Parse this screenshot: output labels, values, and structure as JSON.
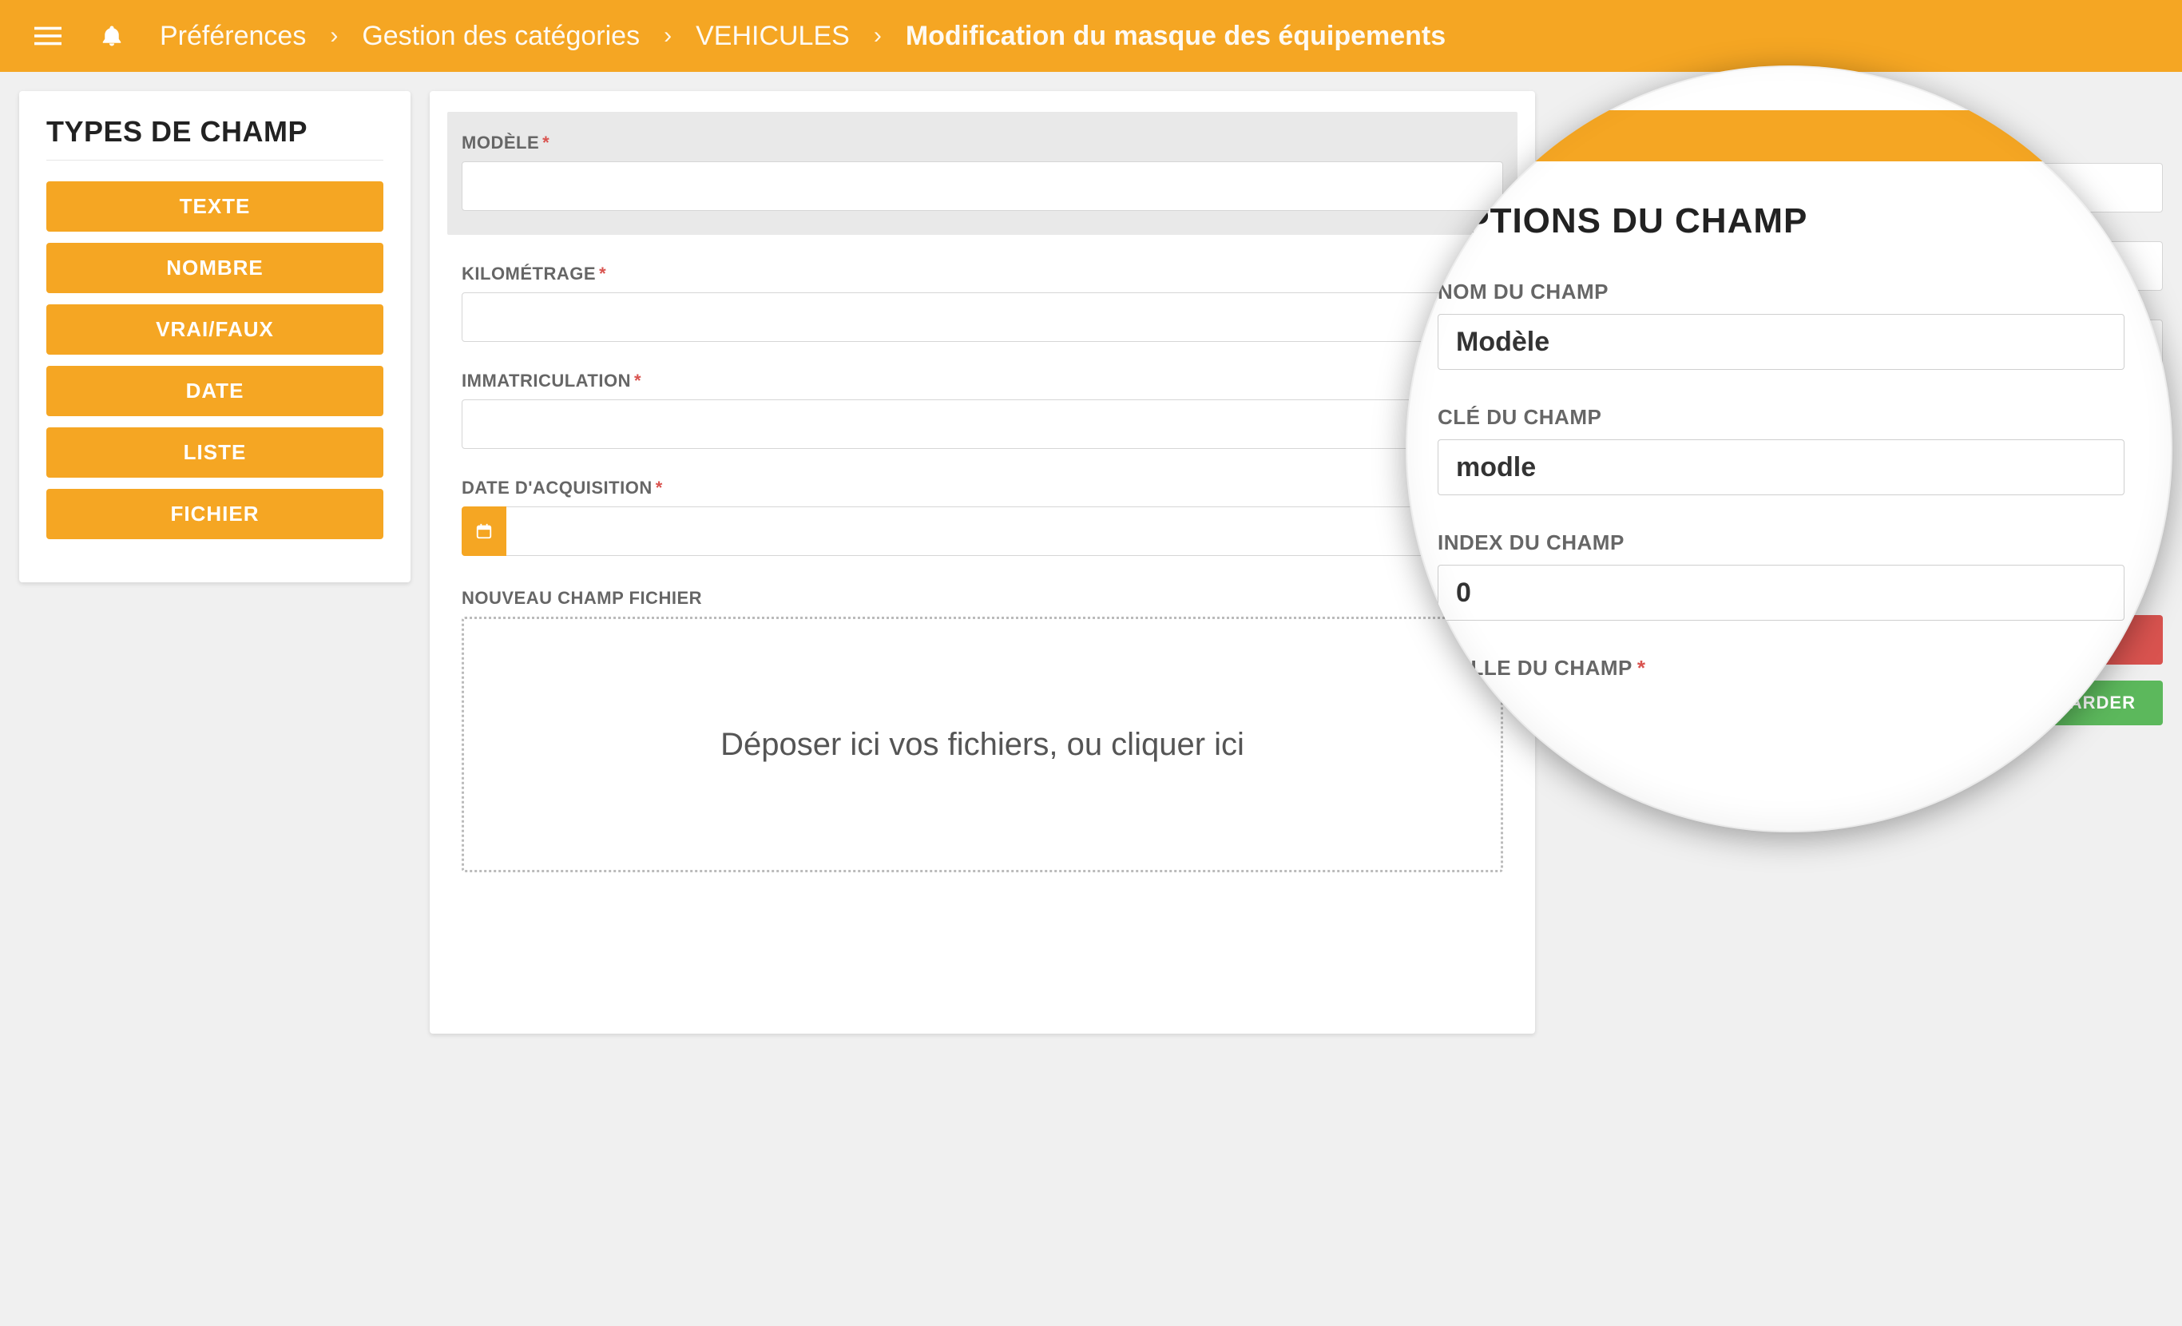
{
  "topbar": {
    "crumbs": [
      "Préférences",
      "Gestion des catégories",
      "VEHICULES",
      "Modification du masque des équipements"
    ]
  },
  "sidebar": {
    "title": "TYPES DE CHAMP",
    "buttons": [
      "TEXTE",
      "NOMBRE",
      "VRAI/FAUX",
      "DATE",
      "LISTE",
      "FICHIER"
    ]
  },
  "form": {
    "modele_label": "MODÈLE",
    "kilometrage_label": "KILOMÉTRAGE",
    "immatriculation_label": "IMMATRICULATION",
    "date_acq_label": "DATE D'ACQUISITION",
    "fichier_label": "NOUVEAU CHAMP FICHIER",
    "dropzone_text": "Déposer ici vos fichiers, ou cliquer ici"
  },
  "actions": {
    "save": "SAUVEGARDER"
  },
  "lens": {
    "title": "OPTIONS DU CHAMP",
    "nom_label": "NOM DU CHAMP",
    "nom_value": "Modèle",
    "cle_label": "CLÉ DU CHAMP",
    "cle_value": "modle",
    "index_label": "INDEX DU CHAMP",
    "index_value": "0",
    "taille_label": "TAILLE DU CHAMP"
  }
}
